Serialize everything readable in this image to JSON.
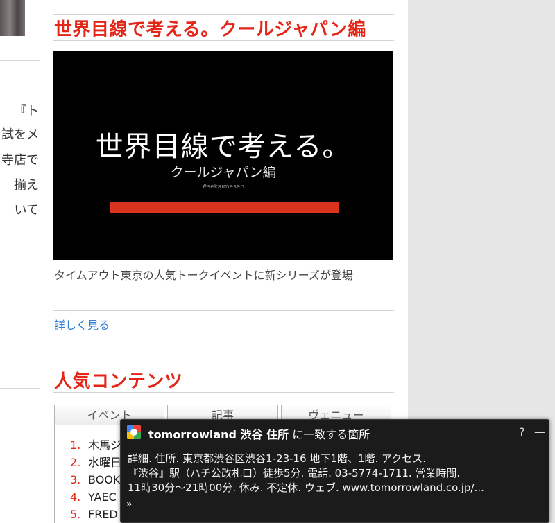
{
  "left": {
    "fragments": [
      "『ト",
      "試をメ",
      "寺店で",
      "揃え",
      "いて"
    ]
  },
  "feature": {
    "section_title": "世界目線で考える。クールジャパン編",
    "banner_title": "世界目線で考える。",
    "banner_subtitle": "クールジャパン編",
    "banner_hashtag": "#sekaimesen",
    "caption": "タイムアウト東京の人気トークイベントに新シリーズが登場",
    "more_link": "詳しく見る"
  },
  "popular": {
    "section_title": "人気コンテンツ",
    "tabs": [
      "イベント",
      "記事",
      "ヴェニュー"
    ],
    "items": [
      {
        "rank": "1.",
        "text": "木馬ジ"
      },
      {
        "rank": "2.",
        "text": "水曜日"
      },
      {
        "rank": "3.",
        "text": "BOOK"
      },
      {
        "rank": "4.",
        "text": "YAEC"
      },
      {
        "rank": "5.",
        "text": "FRED"
      }
    ]
  },
  "popup": {
    "query": "tomorrowland 渋谷 住所",
    "title_suffix": " に一致する箇所",
    "help": "?",
    "minimize": "—",
    "lines": [
      "詳細. 住所. 東京都渋谷区渋谷1-23-16 地下1階、1階. アクセス.",
      "『渋谷』駅（ハチ公改札口）徒歩5分. 電話. 03-5774-1711. 営業時間.",
      "11時30分～21時00分. 休み. 不定休. ウェブ. www.tomorrowland.co.jp/..."
    ],
    "arrow": "»",
    "icon": "google-icon"
  },
  "colors": {
    "accent_red": "#e32618",
    "link_blue": "#2f7fd6",
    "popup_bg": "#1b1b1b",
    "side_gray": "#e6e6e6"
  }
}
